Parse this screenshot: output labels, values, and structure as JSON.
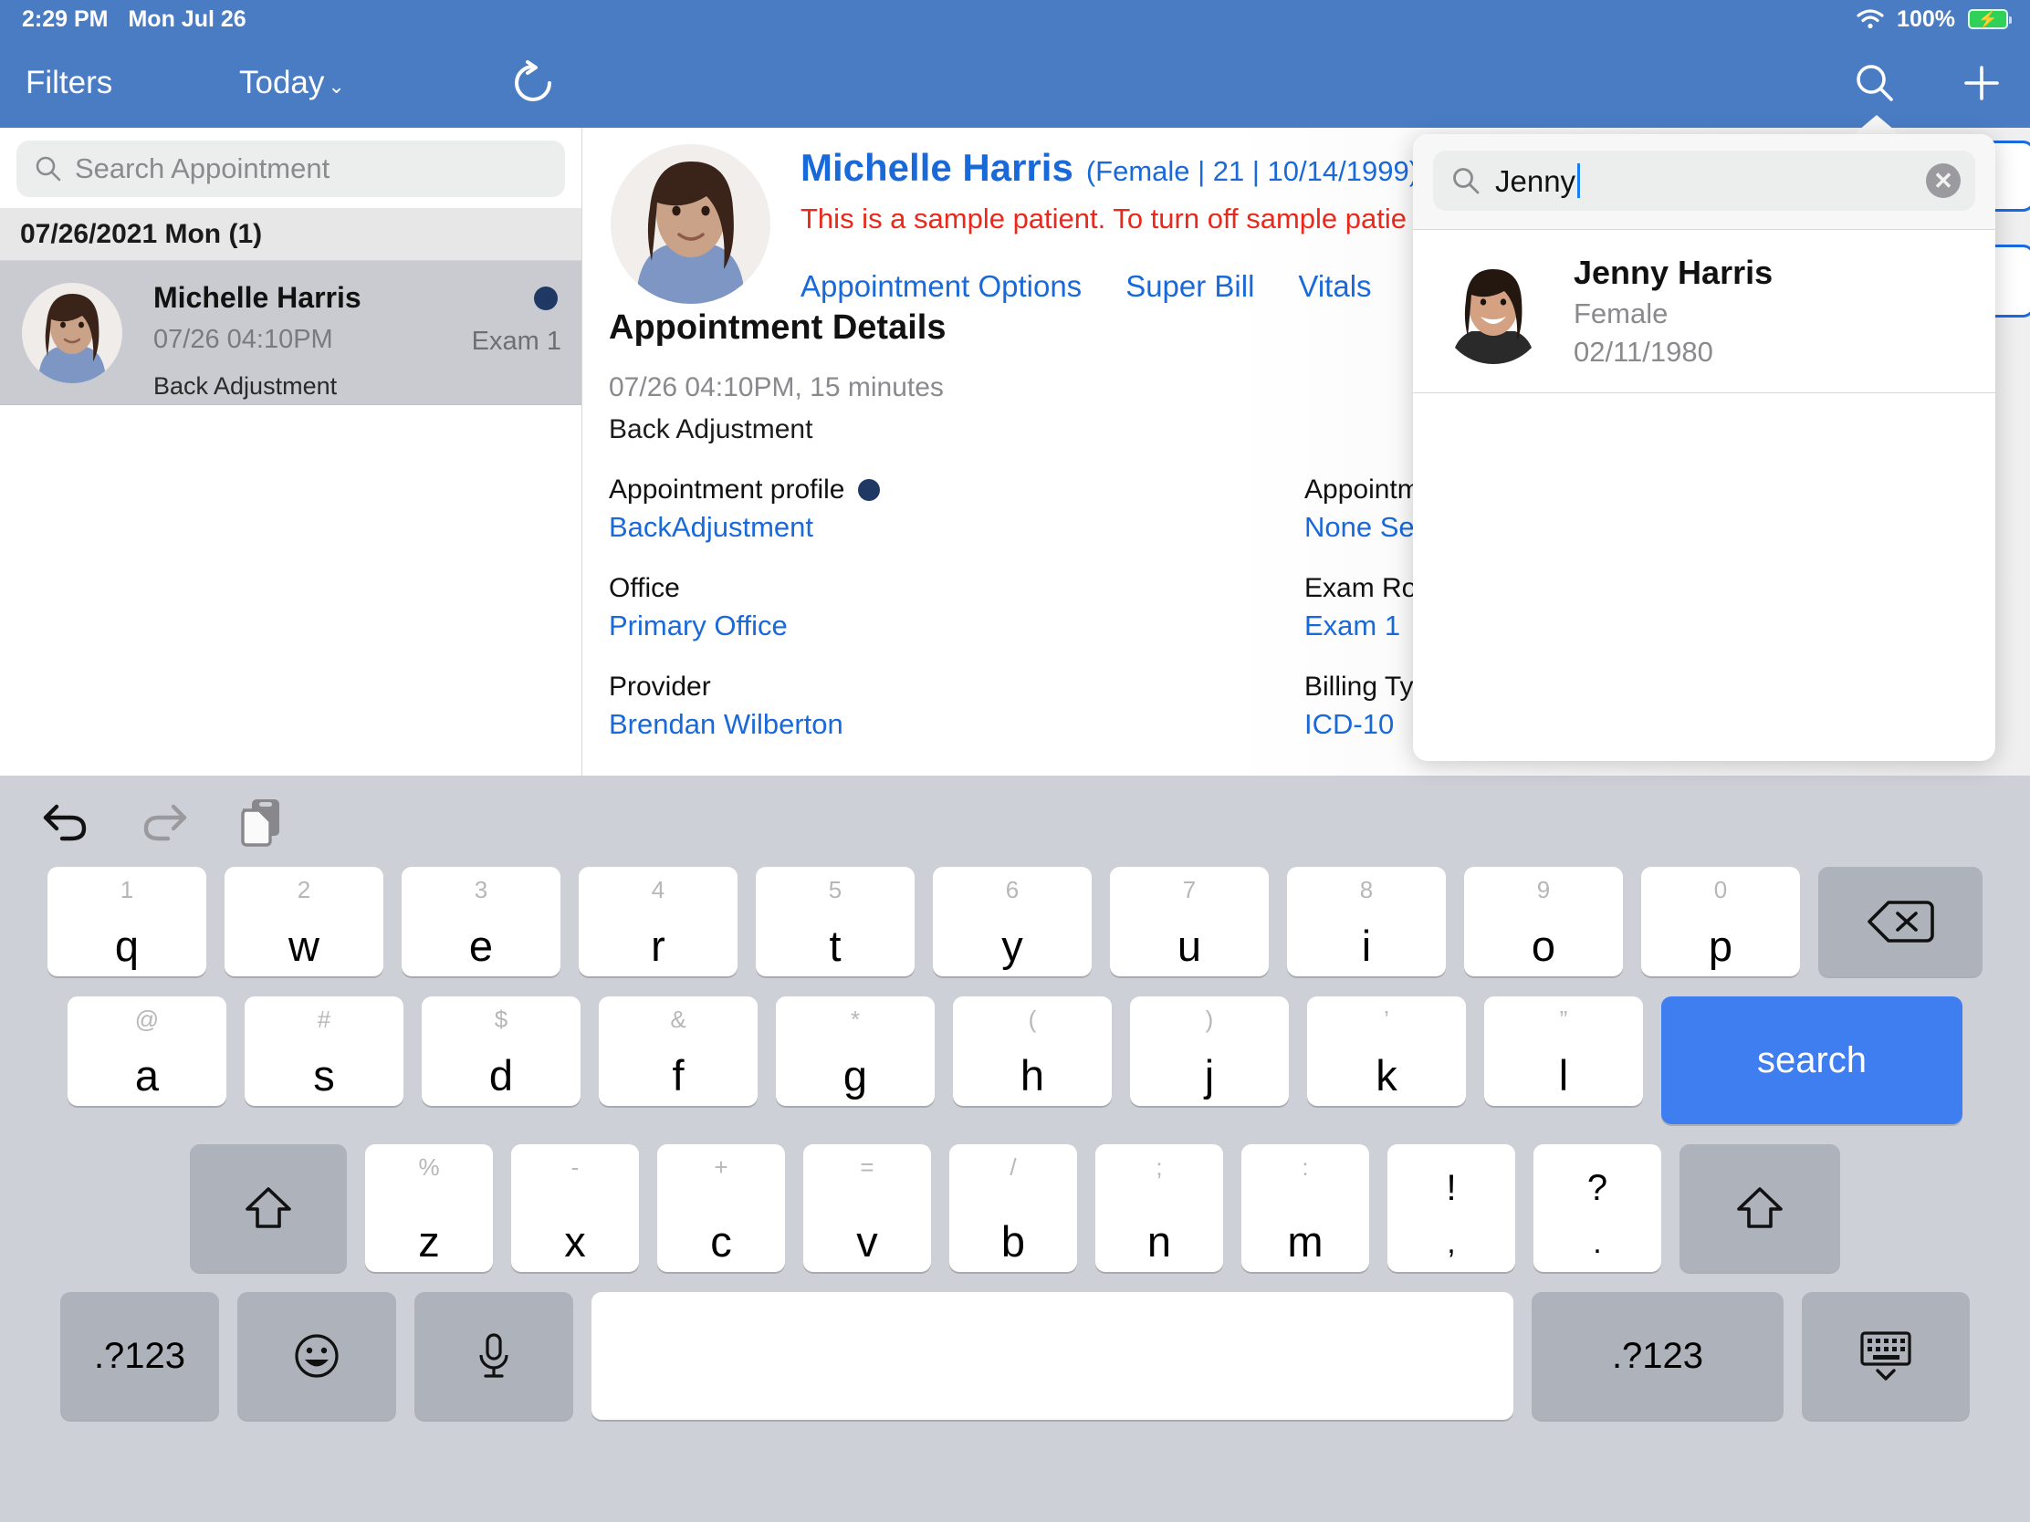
{
  "status_bar": {
    "time": "2:29 PM",
    "date": "Mon Jul 26",
    "battery_percent": "100%",
    "wifi_icon": "wifi-icon",
    "battery_icon": "battery-charging-icon"
  },
  "nav_bar": {
    "filters_label": "Filters",
    "today_label": "Today",
    "chevron": "⌄",
    "refresh_icon": "refresh-icon",
    "search_icon": "search-icon",
    "add_icon": "plus-icon"
  },
  "sidebar": {
    "search": {
      "placeholder": "Search Appointment",
      "value": "",
      "icon": "search-icon"
    },
    "date_header": "07/26/2021 Mon (1)",
    "appointments": [
      {
        "name": "Michelle Harris",
        "time": "07/26 04:10PM",
        "description": "Back Adjustment",
        "room": "Exam 1",
        "status_color": "#1f3864",
        "avatar": "patient-avatar"
      }
    ]
  },
  "detail": {
    "patient_name": "Michelle Harris",
    "patient_meta": "(Female | 21 | 10/14/1999)",
    "chevron": "⌄",
    "warning": "This is a sample patient. To turn off sample patie",
    "links": [
      "Appointment Options",
      "Super Bill",
      "Vitals"
    ],
    "section_title": "Appointment Details",
    "appt_when": "07/26 04:10PM, 15 minutes",
    "appt_type": "Back Adjustment",
    "fields": [
      {
        "left_label": "Appointment profile",
        "left_has_swatch": true,
        "left_value": "BackAdjustment",
        "right_label": "Appointm",
        "right_value": "None Se"
      },
      {
        "left_label": "Office",
        "left_has_swatch": false,
        "left_value": "Primary Office",
        "right_label": "Exam Ro",
        "right_value": "Exam 1"
      },
      {
        "left_label": "Provider",
        "left_has_swatch": false,
        "left_value": "Brendan Wilberton",
        "right_label": "Billing Ty",
        "right_value": "ICD-10"
      }
    ]
  },
  "search_popover": {
    "search_icon": "search-icon",
    "query": "Jenny",
    "clear_icon": "clear-circle-icon",
    "results": [
      {
        "name": "Jenny Harris",
        "gender": "Female",
        "dob": "02/11/1980",
        "avatar": "patient-avatar"
      }
    ]
  },
  "keyboard": {
    "toolbar": {
      "undo_icon": "undo-icon",
      "redo_icon": "redo-icon",
      "paste_icon": "paste-icon"
    },
    "row1": [
      {
        "main": "q",
        "alt": "1"
      },
      {
        "main": "w",
        "alt": "2"
      },
      {
        "main": "e",
        "alt": "3"
      },
      {
        "main": "r",
        "alt": "4"
      },
      {
        "main": "t",
        "alt": "5"
      },
      {
        "main": "y",
        "alt": "6"
      },
      {
        "main": "u",
        "alt": "7"
      },
      {
        "main": "i",
        "alt": "8"
      },
      {
        "main": "o",
        "alt": "9"
      },
      {
        "main": "p",
        "alt": "0"
      }
    ],
    "backspace_icon": "backspace-icon",
    "row2": [
      {
        "main": "a",
        "alt": "@"
      },
      {
        "main": "s",
        "alt": "#"
      },
      {
        "main": "d",
        "alt": "$"
      },
      {
        "main": "f",
        "alt": "&"
      },
      {
        "main": "g",
        "alt": "*"
      },
      {
        "main": "h",
        "alt": "("
      },
      {
        "main": "j",
        "alt": ")"
      },
      {
        "main": "k",
        "alt": "’"
      },
      {
        "main": "l",
        "alt": "”"
      }
    ],
    "search_key_label": "search",
    "shift_left_icon": "shift-icon",
    "shift_right_icon": "shift-icon",
    "row3": [
      {
        "main": "z",
        "alt": "%"
      },
      {
        "main": "x",
        "alt": "-"
      },
      {
        "main": "c",
        "alt": "+"
      },
      {
        "main": "v",
        "alt": "="
      },
      {
        "main": "b",
        "alt": "/"
      },
      {
        "main": "n",
        "alt": ";"
      },
      {
        "main": "m",
        "alt": ":"
      }
    ],
    "row3_punct": [
      {
        "main": "!",
        "sub": ","
      },
      {
        "main": "?",
        "sub": "."
      }
    ],
    "bottom": {
      "numbers_left_label": ".?123",
      "emoji_icon": "emoji-icon",
      "mic_icon": "microphone-icon",
      "space_label": "",
      "numbers_right_label": ".?123",
      "hide_keyboard_icon": "hide-keyboard-icon"
    }
  },
  "colors": {
    "nav_blue": "#4a7cc4",
    "link_blue": "#1969d8",
    "warning_red": "#e8291c",
    "status_dot": "#1f3864",
    "key_blue": "#3f7ef0",
    "keyboard_bg": "#cdd0d6"
  }
}
